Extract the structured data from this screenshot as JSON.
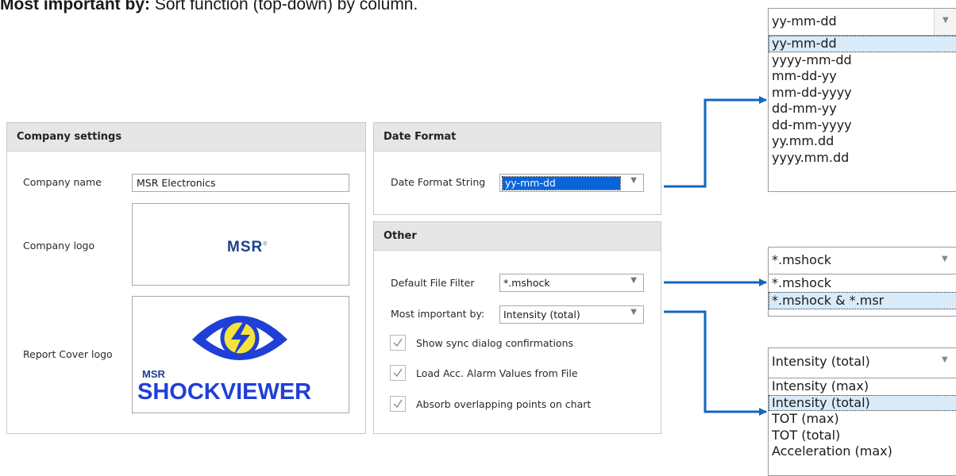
{
  "caption": {
    "bold": "Most important by:",
    "rest": " Sort function (top-down) by column."
  },
  "company": {
    "title": "Company settings",
    "name_label": "Company name",
    "name_value": "MSR Electronics",
    "logo_label": "Company logo",
    "logo_text": "MSR",
    "logo_mark": "®",
    "cover_label": "Report Cover logo",
    "cover_msr": "MSR",
    "cover_text": "SHOCKVIEWER"
  },
  "date_format": {
    "title": "Date Format",
    "label": "Date Format String",
    "value": "yy-mm-dd"
  },
  "other": {
    "title": "Other",
    "filter_label": "Default File Filter",
    "filter_value": "*.mshock",
    "sort_label": "Most important by:",
    "sort_value": "Intensity (total)",
    "checks": [
      {
        "label": "Show sync dialog confirmations",
        "checked": true
      },
      {
        "label": "Load Acc. Alarm Values from File",
        "checked": true
      },
      {
        "label": "Absorb overlapping points on chart",
        "checked": true
      }
    ]
  },
  "date_dropdown": {
    "value": "yy-mm-dd",
    "options": [
      "yy-mm-dd",
      "yyyy-mm-dd",
      "mm-dd-yy",
      "mm-dd-yyyy",
      "dd-mm-yy",
      "dd-mm-yyyy",
      "yy.mm.dd",
      "yyyy.mm.dd"
    ],
    "highlighted": 0
  },
  "filter_dropdown": {
    "value": "*.mshock",
    "options": [
      "*.mshock",
      "*.mshock & *.msr"
    ],
    "highlighted": 1
  },
  "sort_dropdown": {
    "value": "Intensity (total)",
    "options": [
      "Intensity (max)",
      "Intensity (total)",
      "TOT (max)",
      "TOT (total)",
      "Acceleration (max)"
    ],
    "highlighted": 1
  },
  "colors": {
    "arrow": "#1565c0",
    "selection": "#0a64d9",
    "highlight": "#d9ebf9",
    "header_bg": "#e6e6e6"
  }
}
